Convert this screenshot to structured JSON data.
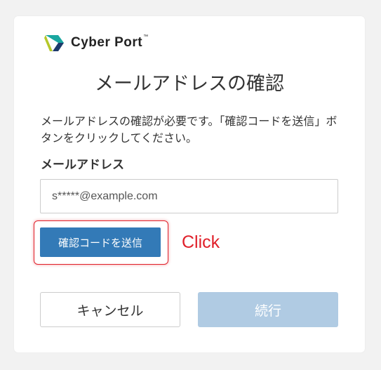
{
  "brand": {
    "name": "Cyber Port",
    "trademark": "™",
    "logo_icon": "cyberport-logo-icon",
    "colors": {
      "logo_teal": "#1aa7a0",
      "logo_navy": "#1d3a6b",
      "logo_lime": "#b5c82a"
    }
  },
  "page": {
    "title": "メールアドレスの確認",
    "description": "メールアドレスの確認が必要です。「確認コードを送信」ボタンをクリックしてください。"
  },
  "form": {
    "email_label": "メールアドレス",
    "email_value": "s*****@example.com",
    "email_placeholder": ""
  },
  "buttons": {
    "send_code": "確認コードを送信",
    "cancel": "キャンセル",
    "continue": "続行"
  },
  "annotation": {
    "click_label": "Click",
    "color": "#e0202a"
  },
  "colors": {
    "primary": "#337ab7",
    "primary_disabled": "#b0cbe3",
    "background": "#f2f2f2"
  }
}
